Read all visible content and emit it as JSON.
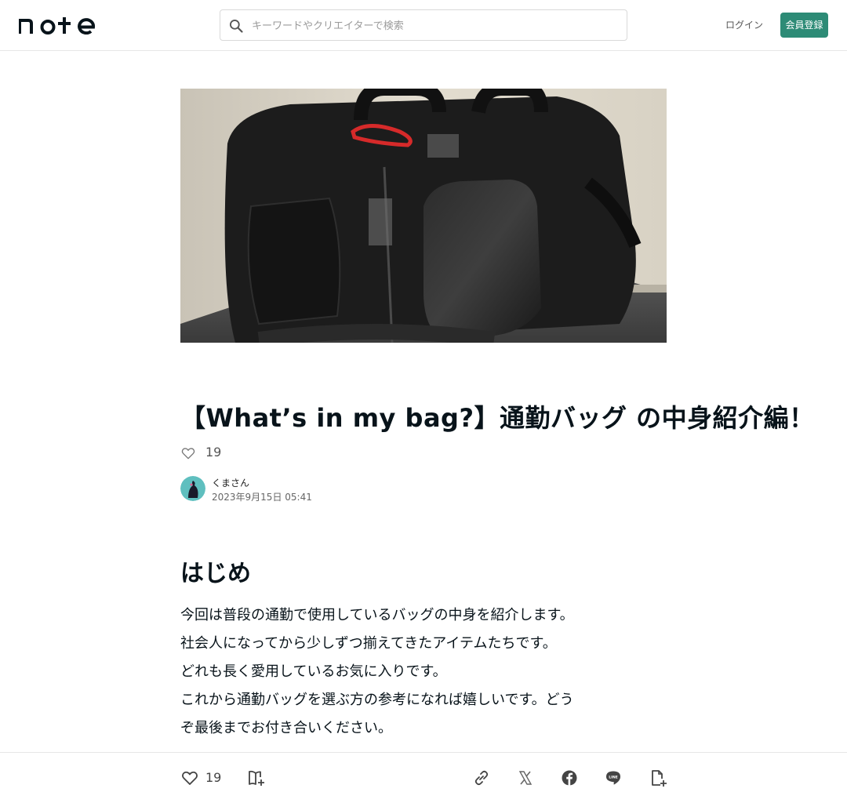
{
  "header": {
    "logo_text": "note",
    "search_placeholder": "キーワードやクリエイターで検索",
    "login_label": "ログイン",
    "signup_label": "会員登録"
  },
  "article": {
    "title": "【What’s in my bag?】通勤バッグ の中身紹介編！",
    "likes": "19",
    "author_name": "くまさん",
    "date": "2023年9月15日 05:41",
    "section_heading": "はじめ",
    "body_lines": [
      "今回は普段の通勤で使用しているバッグの中身を紹介します。",
      "社会人になってから少しずつ揃えてきたアイテムたちです。",
      "どれも長く愛用しているお気に入りです。",
      "これから通勤バッグを選ぶ方の参考になれば嬉しいです。どう",
      "ぞ最後までお付き合いください。",
      "――――――――――――――――――――――――――――"
    ]
  },
  "bottom_bar": {
    "like_count": "19"
  },
  "colors": {
    "accent": "#2d8b76",
    "text": "#08131a"
  },
  "icons": [
    "search-icon",
    "heart-icon",
    "magazine-add-icon",
    "link-icon",
    "x-icon",
    "facebook-icon",
    "line-icon",
    "note-add-icon"
  ]
}
